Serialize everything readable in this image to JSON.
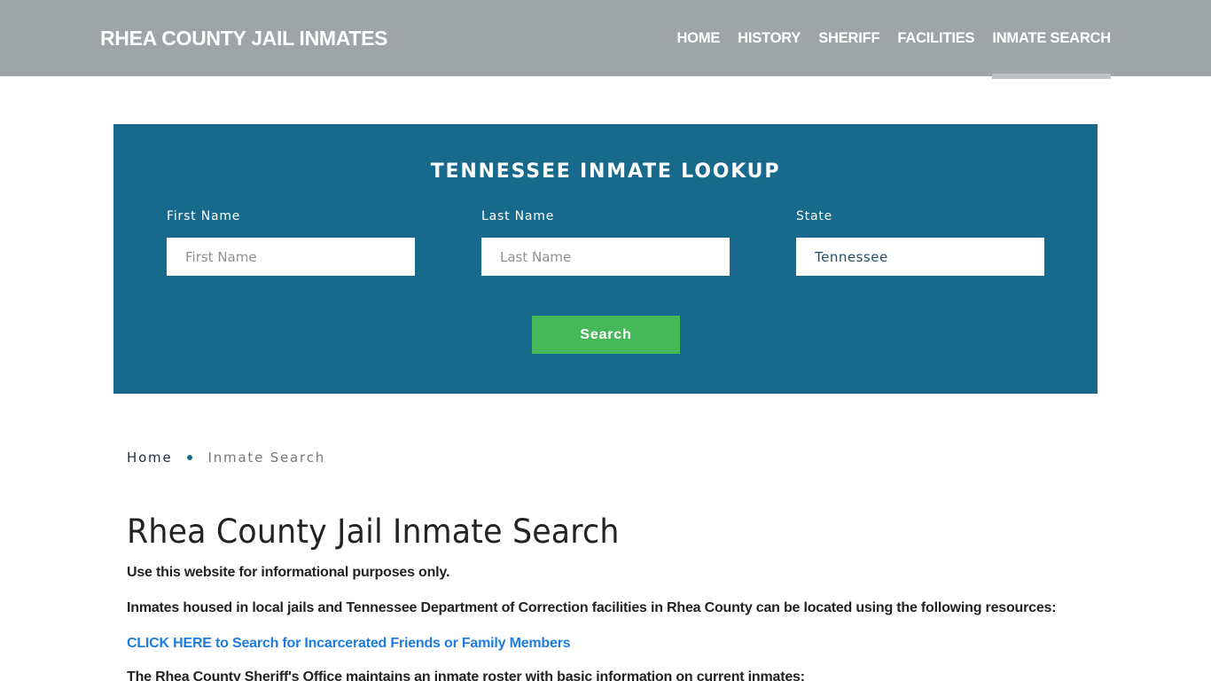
{
  "header": {
    "brand": "RHEA COUNTY JAIL INMATES",
    "nav": [
      {
        "label": "HOME",
        "active": false
      },
      {
        "label": "HISTORY",
        "active": false
      },
      {
        "label": "SHERIFF",
        "active": false
      },
      {
        "label": "FACILITIES",
        "active": false
      },
      {
        "label": "INMATE SEARCH",
        "active": true
      }
    ]
  },
  "lookup": {
    "title": "TENNESSEE INMATE LOOKUP",
    "fields": {
      "first_name": {
        "label": "First Name",
        "placeholder": "First Name",
        "value": ""
      },
      "last_name": {
        "label": "Last Name",
        "placeholder": "Last Name",
        "value": ""
      },
      "state": {
        "label": "State",
        "placeholder": "",
        "value": "Tennessee"
      }
    },
    "search_label": "Search"
  },
  "breadcrumb": {
    "home": "Home",
    "current": "Inmate Search"
  },
  "content": {
    "title": "Rhea County Jail Inmate Search",
    "paragraphs": [
      "Use this website for informational purposes only.",
      "Inmates housed in local jails and Tennessee Department of Correction facilities in Rhea County can be located using the following resources:"
    ],
    "link": "CLICK HERE to Search for Incarcerated Friends or Family Members",
    "paragraph_after_link": "The Rhea County Sheriff's Office maintains an inmate roster with basic information on current inmates:"
  },
  "colors": {
    "header_bg": "#9fa4a7",
    "lookup_bg": "#176a8c",
    "search_button": "#45b857",
    "link": "#1c7ce0"
  }
}
